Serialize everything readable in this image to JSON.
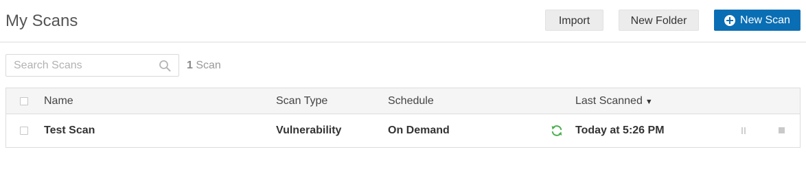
{
  "header": {
    "title": "My Scans",
    "import_label": "Import",
    "new_folder_label": "New Folder",
    "new_scan_label": "New Scan"
  },
  "search": {
    "placeholder": "Search Scans",
    "value": "",
    "count": "1",
    "count_label": "Scan"
  },
  "table": {
    "columns": {
      "name": "Name",
      "scan_type": "Scan Type",
      "schedule": "Schedule",
      "last_scanned": "Last Scanned",
      "sort_indicator": "▼"
    },
    "rows": [
      {
        "name": "Test Scan",
        "scan_type": "Vulnerability",
        "schedule": "On Demand",
        "status_icon": "refresh-icon",
        "last_scanned": "Today at 5:26 PM"
      }
    ]
  },
  "colors": {
    "primary_button": "#0a6eb4",
    "status_running": "#4caf50"
  }
}
